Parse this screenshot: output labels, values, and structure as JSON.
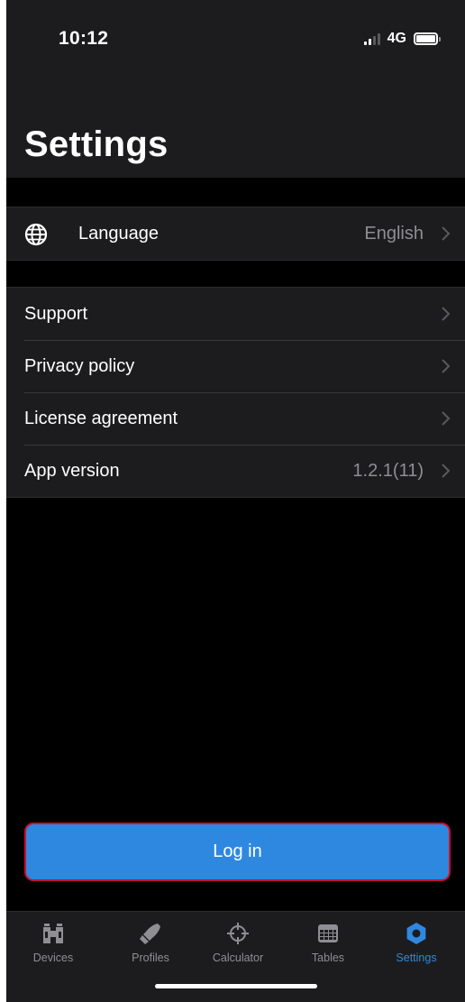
{
  "status_bar": {
    "time": "10:12",
    "network": "4G"
  },
  "header": {
    "title": "Settings"
  },
  "language_row": {
    "icon": "globe-icon",
    "label": "Language",
    "value": "English"
  },
  "menu": {
    "items": [
      {
        "label": "Support",
        "value": ""
      },
      {
        "label": "Privacy policy",
        "value": ""
      },
      {
        "label": "License agreement",
        "value": ""
      },
      {
        "label": "App version",
        "value": "1.2.1(11)"
      }
    ]
  },
  "login_button": {
    "label": "Log in"
  },
  "tabbar": {
    "items": [
      {
        "label": "Devices",
        "icon": "binoculars-icon",
        "active": false
      },
      {
        "label": "Profiles",
        "icon": "bullet-icon",
        "active": false
      },
      {
        "label": "Calculator",
        "icon": "crosshair-icon",
        "active": false
      },
      {
        "label": "Tables",
        "icon": "table-icon",
        "active": false
      },
      {
        "label": "Settings",
        "icon": "gear-icon",
        "active": true
      }
    ]
  },
  "colors": {
    "background": "#000000",
    "surface": "#1c1c1e",
    "accent": "#2f88e0",
    "secondary_text": "#8e8e93",
    "button_outline": "#c8102e"
  }
}
